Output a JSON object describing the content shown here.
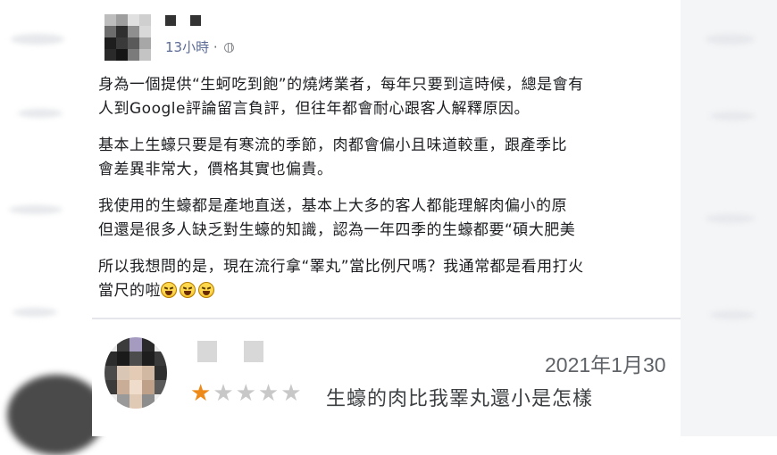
{
  "post": {
    "time": "13小時",
    "separator": "·",
    "privacy_icon": "globe-icon",
    "paragraphs": [
      "身為一個提供“生蚵吃到飽”的燒烤業者，每年只要到這時候，總是會有",
      "人到Google評論留言負評，但往年都會耐心跟客人解釋原因。",
      "基本上生蠔只要是有寒流的季節，肉都會偏小且味道較重，跟產季比",
      "會差異非常大，價格其實也偏貴。",
      "我使用的生蠔都是產地直送，基本上大多的客人都能理解肉偏小的原",
      "但還是很多人缺乏對生蠔的知識，認為一年四季的生蠔都要“碩大肥美",
      "所以我想問的是，現在流行拿“睪丸”當比例尺嗎？我通常都是看用打火",
      "當尺的啦"
    ],
    "emoji_icon": "laughing-crying-emoji-icon",
    "emoji_count": 3
  },
  "review": {
    "date": "2021年1月30",
    "rating": 1,
    "max_rating": 5,
    "star_on": "★",
    "star_off": "★★★★",
    "text": "生蠔的肉比我睪丸還小是怎樣"
  },
  "colors": {
    "star_active": "#ed8a19",
    "star_inactive": "#c8c8c8",
    "meta_text": "#5b6b95"
  }
}
